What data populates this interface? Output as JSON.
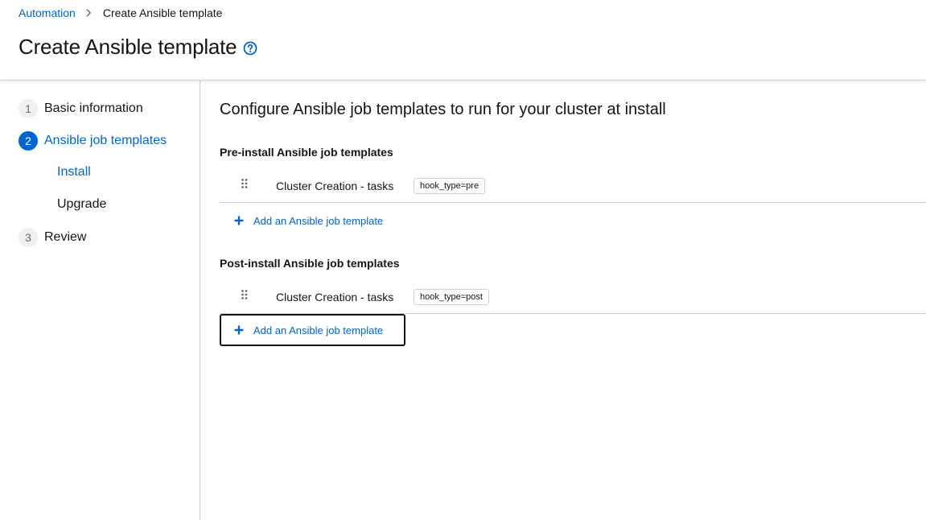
{
  "breadcrumb": {
    "parent": "Automation",
    "current": "Create Ansible template"
  },
  "header": {
    "title": "Create Ansible template",
    "help_icon": "question-circle-icon"
  },
  "wizard_nav": {
    "steps": [
      {
        "number": "1",
        "label": "Basic information",
        "active": false
      },
      {
        "number": "2",
        "label": "Ansible job templates",
        "active": true
      },
      {
        "number": "3",
        "label": "Review",
        "active": false
      }
    ],
    "substeps": [
      {
        "label": "Install",
        "active": true
      },
      {
        "label": "Upgrade",
        "active": false
      }
    ]
  },
  "main": {
    "title": "Configure Ansible job templates to run for your cluster at install",
    "pre_install": {
      "title": "Pre-install Ansible job templates",
      "templates": [
        {
          "name": "Cluster Creation - tasks",
          "label": "hook_type=pre"
        }
      ],
      "add_label": "Add an Ansible job template"
    },
    "post_install": {
      "title": "Post-install Ansible job templates",
      "templates": [
        {
          "name": "Cluster Creation - tasks",
          "label": "hook_type=post"
        }
      ],
      "add_label": "Add an Ansible job template"
    }
  },
  "colors": {
    "accent": "#0066cc",
    "text": "#151515",
    "border": "#d2d2d2"
  }
}
